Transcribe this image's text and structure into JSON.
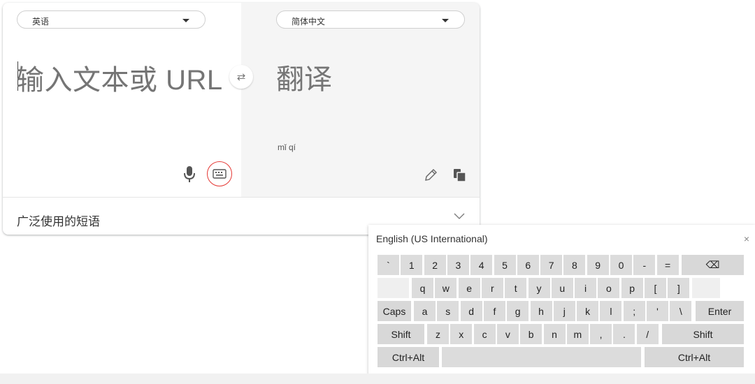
{
  "translator": {
    "source_lang": "英语",
    "target_lang": "简体中文",
    "source_placeholder": "输入文本或 URL",
    "translation": "翻译",
    "pinyin": "mǐ qí",
    "swap_icon": "⇄",
    "phrases_label": "广泛使用的短语"
  },
  "keyboard": {
    "title": "English (US International)",
    "close": "×",
    "row1": [
      "`",
      "1",
      "2",
      "3",
      "4",
      "5",
      "6",
      "7",
      "8",
      "9",
      "0",
      "-",
      "="
    ],
    "row2": [
      "q",
      "w",
      "e",
      "r",
      "t",
      "y",
      "u",
      "i",
      "o",
      "p",
      "[",
      "]"
    ],
    "row3": [
      "a",
      "s",
      "d",
      "f",
      "g",
      "h",
      "j",
      "k",
      "l",
      ";",
      "'",
      "\\"
    ],
    "row4": [
      "z",
      "x",
      "c",
      "v",
      "b",
      "n",
      "m",
      ",",
      ".",
      "/"
    ],
    "caps": "Caps",
    "enter": "Enter",
    "shift_left": "Shift",
    "shift_right": "Shift",
    "ctrl_alt_left": "Ctrl+Alt",
    "ctrl_alt_right": "Ctrl+Alt",
    "backspace_icon": "⌫"
  },
  "colors": {
    "accent_red": "#e53935",
    "key_bg": "#dcdcdc",
    "right_pane_bg": "#f5f5f5"
  }
}
